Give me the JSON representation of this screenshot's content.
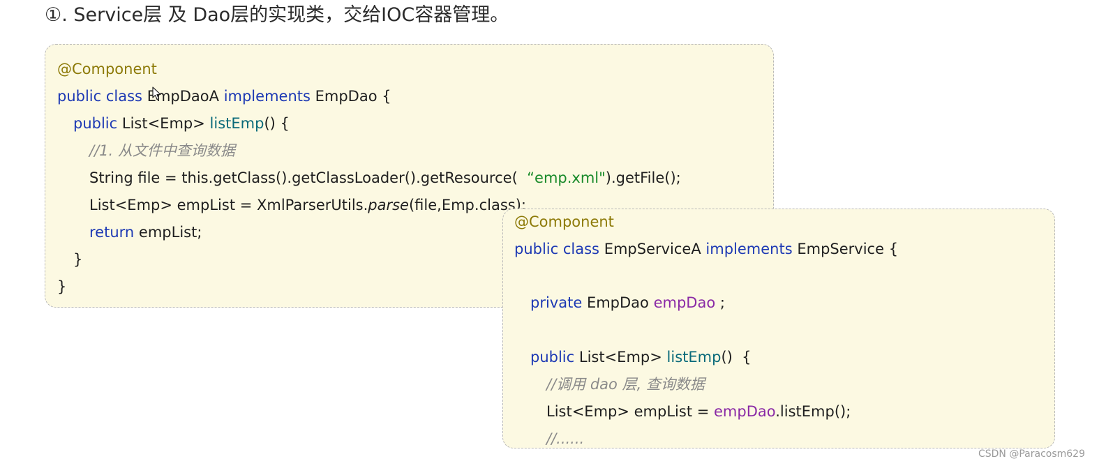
{
  "heading": "①. Service层 及 Dao层的实现类，交给IOC容器管理。",
  "watermark": "CSDN @Paracosm629",
  "dao_code": {
    "annotation": "@Component",
    "l2_kw": "public class",
    "l2_cls": "EmpDaoA",
    "l2_impl": "implements",
    "l2_iface": "EmpDao {",
    "l3_kw": "public",
    "l3_type": "List<Emp>",
    "l3_fn": "listEmp",
    "l3_rest": "() {",
    "l4_comment": "//1. 从文件中查询数据",
    "l5_pre": "String file = this.getClass().getClassLoader().getResource(",
    "l5_str": "“emp.xml\"",
    "l5_post": ").getFile();",
    "l6_pre": "List<Emp> empList = XmlParserUtils.",
    "l6_method": "parse",
    "l6_post": "(file,Emp.class);",
    "l7_kw": "return",
    "l7_rest": "empList;",
    "l8": "}",
    "l9": "}"
  },
  "service_code": {
    "annotation": "@Component",
    "l2_kw": "public class",
    "l2_cls": "EmpServiceA",
    "l2_impl": "implements",
    "l2_iface": "EmpService {",
    "l3_kw": "private",
    "l3_type": "EmpDao",
    "l3_field": "empDao",
    "l3_end": ";",
    "l4_kw": "public",
    "l4_type": "List<Emp>",
    "l4_fn": "listEmp",
    "l4_rest": "()  {",
    "l5_comment": "//调用 dao 层, 查询数据",
    "l6_pre": "List<Emp> empList =",
    "l6_field": "empDao",
    "l6_post": ".listEmp();",
    "l7_comment": "//......"
  },
  "colors": {
    "keyword": "#1d39b4",
    "function": "#0a6a7a",
    "annotation": "#8d7a08",
    "string": "#198a2a",
    "field": "#8a2aa6",
    "comment": "#8a8a8a",
    "box_background": "#fcf9e2"
  },
  "icons": [
    "mouse-pointer-icon"
  ]
}
